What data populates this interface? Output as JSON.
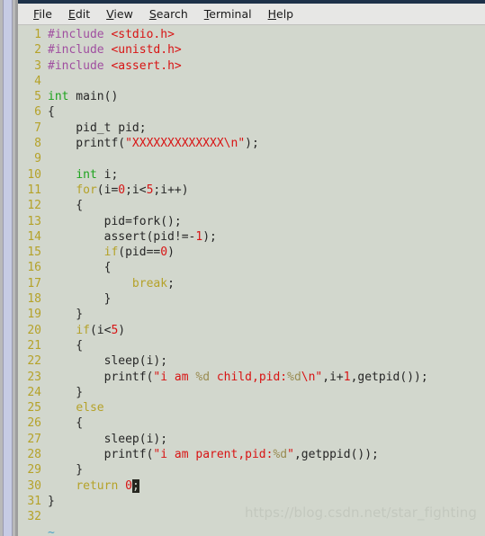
{
  "window": {
    "accent_titlebar_color": "#1d3149",
    "background_color": "#d2d7cd",
    "menubar_color": "#e7e7e5"
  },
  "menubar": {
    "items": [
      {
        "label": "File",
        "mnemonic": "F",
        "rest": "ile"
      },
      {
        "label": "Edit",
        "mnemonic": "E",
        "rest": "dit"
      },
      {
        "label": "View",
        "mnemonic": "V",
        "rest": "iew"
      },
      {
        "label": "Search",
        "mnemonic": "S",
        "rest": "earch"
      },
      {
        "label": "Terminal",
        "mnemonic": "T",
        "rest": "erminal"
      },
      {
        "label": "Help",
        "mnemonic": "H",
        "rest": "elp"
      }
    ]
  },
  "scrollbar": {
    "orientation": "vertical",
    "position": "left",
    "thumb_color": "#c6cbe4"
  },
  "editor": {
    "language": "C",
    "cursor_line": 30,
    "cursor_char": ";",
    "last_line_marker": "~",
    "total_lines": 32,
    "colors": {
      "line_number": "#b5a229",
      "preprocessor": "#a04fa0",
      "header": "#d81414",
      "type": "#1ea31e",
      "keyword": "#b5a229",
      "string": "#d81414",
      "format_spec": "#9a8c52",
      "number": "#d81414",
      "plain": "#262626",
      "cursor_block": "#26261f"
    },
    "lines": [
      {
        "n": "1",
        "tokens": [
          {
            "t": "pre",
            "v": "#include"
          },
          {
            "t": "plain",
            "v": " "
          },
          {
            "t": "hdr",
            "v": "<stdio.h>"
          }
        ]
      },
      {
        "n": "2",
        "tokens": [
          {
            "t": "pre",
            "v": "#include"
          },
          {
            "t": "plain",
            "v": " "
          },
          {
            "t": "hdr",
            "v": "<unistd.h>"
          }
        ]
      },
      {
        "n": "3",
        "tokens": [
          {
            "t": "pre",
            "v": "#include"
          },
          {
            "t": "plain",
            "v": " "
          },
          {
            "t": "hdr",
            "v": "<assert.h>"
          }
        ]
      },
      {
        "n": "4",
        "tokens": []
      },
      {
        "n": "5",
        "tokens": [
          {
            "t": "type",
            "v": "int"
          },
          {
            "t": "plain",
            "v": " main()"
          }
        ]
      },
      {
        "n": "6",
        "tokens": [
          {
            "t": "plain",
            "v": "{"
          }
        ]
      },
      {
        "n": "7",
        "tokens": [
          {
            "t": "plain",
            "v": "    pid_t pid;"
          }
        ]
      },
      {
        "n": "8",
        "tokens": [
          {
            "t": "plain",
            "v": "    printf("
          },
          {
            "t": "str",
            "v": "\"XXXXXXXXXXXXX\\n\""
          },
          {
            "t": "plain",
            "v": ");"
          }
        ]
      },
      {
        "n": "9",
        "tokens": []
      },
      {
        "n": "10",
        "tokens": [
          {
            "t": "plain",
            "v": "    "
          },
          {
            "t": "type",
            "v": "int"
          },
          {
            "t": "plain",
            "v": " i;"
          }
        ]
      },
      {
        "n": "11",
        "tokens": [
          {
            "t": "plain",
            "v": "    "
          },
          {
            "t": "kw",
            "v": "for"
          },
          {
            "t": "plain",
            "v": "(i="
          },
          {
            "t": "num",
            "v": "0"
          },
          {
            "t": "plain",
            "v": ";i<"
          },
          {
            "t": "num",
            "v": "5"
          },
          {
            "t": "plain",
            "v": ";i++)"
          }
        ]
      },
      {
        "n": "12",
        "tokens": [
          {
            "t": "plain",
            "v": "    {"
          }
        ]
      },
      {
        "n": "13",
        "tokens": [
          {
            "t": "plain",
            "v": "        pid=fork();"
          }
        ]
      },
      {
        "n": "14",
        "tokens": [
          {
            "t": "plain",
            "v": "        assert(pid!=-"
          },
          {
            "t": "num",
            "v": "1"
          },
          {
            "t": "plain",
            "v": ");"
          }
        ]
      },
      {
        "n": "15",
        "tokens": [
          {
            "t": "plain",
            "v": "        "
          },
          {
            "t": "kw",
            "v": "if"
          },
          {
            "t": "plain",
            "v": "(pid=="
          },
          {
            "t": "num",
            "v": "0"
          },
          {
            "t": "plain",
            "v": ")"
          }
        ]
      },
      {
        "n": "16",
        "tokens": [
          {
            "t": "plain",
            "v": "        {"
          }
        ]
      },
      {
        "n": "17",
        "tokens": [
          {
            "t": "plain",
            "v": "            "
          },
          {
            "t": "kw",
            "v": "break"
          },
          {
            "t": "plain",
            "v": ";"
          }
        ]
      },
      {
        "n": "18",
        "tokens": [
          {
            "t": "plain",
            "v": "        }"
          }
        ]
      },
      {
        "n": "19",
        "tokens": [
          {
            "t": "plain",
            "v": "    }"
          }
        ]
      },
      {
        "n": "20",
        "tokens": [
          {
            "t": "plain",
            "v": "    "
          },
          {
            "t": "kw",
            "v": "if"
          },
          {
            "t": "plain",
            "v": "(i<"
          },
          {
            "t": "num",
            "v": "5"
          },
          {
            "t": "plain",
            "v": ")"
          }
        ]
      },
      {
        "n": "21",
        "tokens": [
          {
            "t": "plain",
            "v": "    {"
          }
        ]
      },
      {
        "n": "22",
        "tokens": [
          {
            "t": "plain",
            "v": "        sleep(i);"
          }
        ]
      },
      {
        "n": "23",
        "tokens": [
          {
            "t": "plain",
            "v": "        printf("
          },
          {
            "t": "str",
            "v": "\"i am "
          },
          {
            "t": "fmt",
            "v": "%d"
          },
          {
            "t": "str",
            "v": " child,pid:"
          },
          {
            "t": "fmt",
            "v": "%d"
          },
          {
            "t": "str",
            "v": "\\n\""
          },
          {
            "t": "plain",
            "v": ",i+"
          },
          {
            "t": "num",
            "v": "1"
          },
          {
            "t": "plain",
            "v": ",getpid());"
          }
        ]
      },
      {
        "n": "24",
        "tokens": [
          {
            "t": "plain",
            "v": "    }"
          }
        ]
      },
      {
        "n": "25",
        "tokens": [
          {
            "t": "plain",
            "v": "    "
          },
          {
            "t": "kw",
            "v": "else"
          }
        ]
      },
      {
        "n": "26",
        "tokens": [
          {
            "t": "plain",
            "v": "    {"
          }
        ]
      },
      {
        "n": "27",
        "tokens": [
          {
            "t": "plain",
            "v": "        sleep(i);"
          }
        ]
      },
      {
        "n": "28",
        "tokens": [
          {
            "t": "plain",
            "v": "        printf("
          },
          {
            "t": "str",
            "v": "\"i am parent,pid:"
          },
          {
            "t": "fmt",
            "v": "%d"
          },
          {
            "t": "str",
            "v": "\""
          },
          {
            "t": "plain",
            "v": ",getppid());"
          }
        ]
      },
      {
        "n": "29",
        "tokens": [
          {
            "t": "plain",
            "v": "    }"
          }
        ]
      },
      {
        "n": "30",
        "tokens": [
          {
            "t": "plain",
            "v": "    "
          },
          {
            "t": "kw",
            "v": "return"
          },
          {
            "t": "plain",
            "v": " "
          },
          {
            "t": "num",
            "v": "0"
          },
          {
            "t": "cursor",
            "v": ";"
          }
        ]
      },
      {
        "n": "31",
        "tokens": [
          {
            "t": "plain",
            "v": "}"
          }
        ]
      },
      {
        "n": "32",
        "tokens": []
      },
      {
        "n": "",
        "tokens": [
          {
            "t": "tilde",
            "v": "~"
          }
        ]
      }
    ]
  },
  "watermark": {
    "text": "https://blog.csdn.net/star_fighting",
    "color": "#c3c8be"
  }
}
